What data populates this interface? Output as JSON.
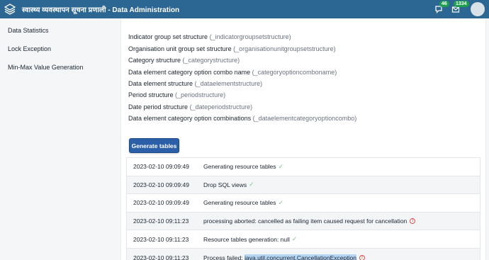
{
  "header": {
    "title": "स्वास्थ्य व्यवस्थापन सूचना प्रणाली - Data Administration",
    "interpretations_count": "46",
    "messages_count": "1334"
  },
  "sidebar": {
    "items": [
      {
        "label": "Data Statistics"
      },
      {
        "label": "Lock Exception"
      },
      {
        "label": "Min-Max Value Generation"
      }
    ]
  },
  "structures": [
    {
      "label": "Indicator group set structure",
      "code": "(_indicatorgroupsetstructure)"
    },
    {
      "label": "Organisation unit group set structure",
      "code": "(_organisationunitgroupsetstructure)"
    },
    {
      "label": "Category structure",
      "code": "(_categorystructure)"
    },
    {
      "label": "Data element category option combo name",
      "code": "(_categoryoptioncomboname)"
    },
    {
      "label": "Data element structure",
      "code": "(_dataelementstructure)"
    },
    {
      "label": "Period structure",
      "code": "(_periodstructure)"
    },
    {
      "label": "Date period structure",
      "code": "(_dateperiodstructure)"
    },
    {
      "label": "Data element category option combinations",
      "code": "(_dataelementcategoryoptioncombo)"
    }
  ],
  "generate_button": "Generate tables",
  "log": [
    {
      "time": "2023-02-10 09:09:49",
      "message": "Generating resource tables",
      "status": "ok"
    },
    {
      "time": "2023-02-10 09:09:49",
      "message": "Drop SQL views",
      "status": "ok"
    },
    {
      "time": "2023-02-10 09:09:49",
      "message": "Generating resource tables",
      "status": "ok"
    },
    {
      "time": "2023-02-10 09:11:23",
      "message": "processing aborted: cancelled as failing item caused request for cancellation",
      "status": "error"
    },
    {
      "time": "2023-02-10 09:11:23",
      "message": "Resource tables generation: null",
      "status": "ok"
    },
    {
      "time": "2023-02-10 09:11:23",
      "message": "Process failed:",
      "message_highlight": "java.util.concurrent.CancellationException",
      "status": "error"
    }
  ],
  "colors": {
    "header": "#2c6693",
    "button": "#2b5fa8",
    "badge": "#1e9e4f",
    "error": "#d9534f",
    "ok": "#7fc48a"
  }
}
